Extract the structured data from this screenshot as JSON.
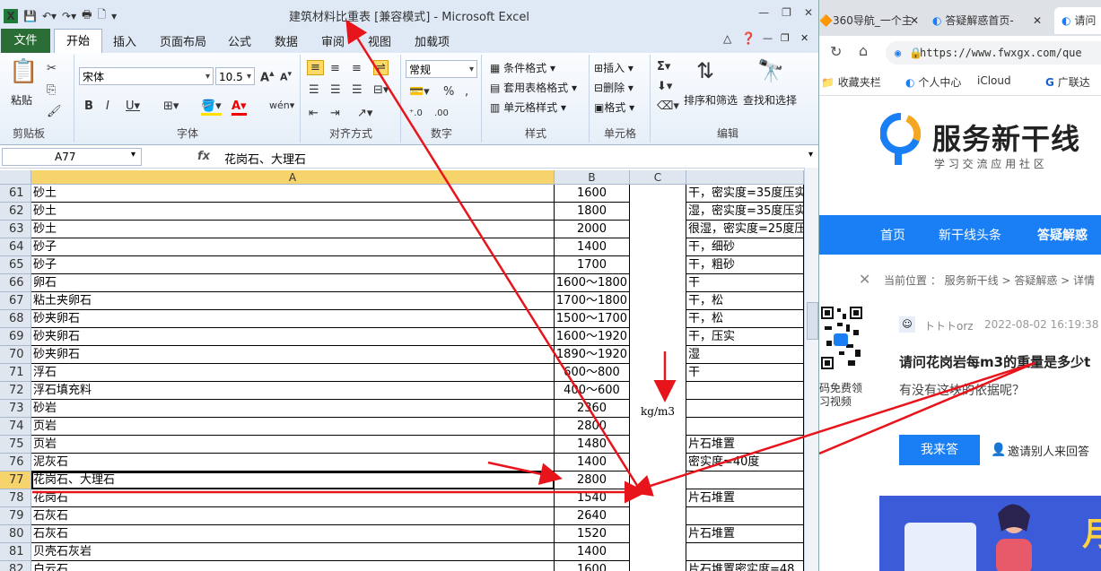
{
  "excel": {
    "window_title": "建筑材料比重表 [兼容模式] - Microsoft Excel",
    "tabs": [
      "文件",
      "开始",
      "插入",
      "页面布局",
      "公式",
      "数据",
      "审阅",
      "视图",
      "加载项"
    ],
    "groups": {
      "clipboard": {
        "label": "剪贴板",
        "paste": "粘贴"
      },
      "font": {
        "label": "字体",
        "font_name": "宋体",
        "font_size": "10.5"
      },
      "alignment": {
        "label": "对齐方式"
      },
      "number": {
        "label": "数字",
        "format": "常规"
      },
      "styles": {
        "label": "样式",
        "cond_format": "条件格式",
        "table_format": "套用表格格式",
        "cell_style": "单元格样式"
      },
      "cells": {
        "label": "单元格",
        "insert": "插入",
        "delete": "删除",
        "format": "格式"
      },
      "editing": {
        "label": "编辑",
        "sort_filter": "排序和筛选",
        "find_select": "查找和选择"
      }
    },
    "name_box": "A77",
    "formula": "花岗石、大理石",
    "columns": [
      "A",
      "B",
      "C"
    ],
    "unit_label": "kg/m3",
    "rows": [
      {
        "n": "61",
        "a": "砂土",
        "b": "1600",
        "d": "干，密实度=35度压实"
      },
      {
        "n": "62",
        "a": "砂土",
        "b": "1800",
        "d": "湿，密实度=35度压实"
      },
      {
        "n": "63",
        "a": "砂土",
        "b": "2000",
        "d": "很湿，密实度=25度压"
      },
      {
        "n": "64",
        "a": "砂子",
        "b": "1400",
        "d": "干，细砂"
      },
      {
        "n": "65",
        "a": "砂子",
        "b": "1700",
        "d": "干，粗砂"
      },
      {
        "n": "66",
        "a": "卵石",
        "b": "1600～1800",
        "d": "干"
      },
      {
        "n": "67",
        "a": "粘土夹卵石",
        "b": "1700～1800",
        "d": "干，松"
      },
      {
        "n": "68",
        "a": "砂夹卵石",
        "b": "1500～1700",
        "d": "干，松"
      },
      {
        "n": "69",
        "a": "砂夹卵石",
        "b": "1600～1920",
        "d": "干，压实"
      },
      {
        "n": "70",
        "a": "砂夹卵石",
        "b": "1890～1920",
        "d": "湿"
      },
      {
        "n": "71",
        "a": "浮石",
        "b": "600～800",
        "d": "干"
      },
      {
        "n": "72",
        "a": "浮石填充料",
        "b": "400～600",
        "d": ""
      },
      {
        "n": "73",
        "a": "砂岩",
        "b": "2360",
        "d": ""
      },
      {
        "n": "74",
        "a": "页岩",
        "b": "2800",
        "d": ""
      },
      {
        "n": "75",
        "a": "页岩",
        "b": "1480",
        "d": "片石堆置"
      },
      {
        "n": "76",
        "a": "泥灰石",
        "b": "1400",
        "d": "密实度=40度"
      },
      {
        "n": "77",
        "a": "花岗石、大理石",
        "b": "2800",
        "d": ""
      },
      {
        "n": "78",
        "a": "花岗石",
        "b": "1540",
        "d": "片石堆置"
      },
      {
        "n": "79",
        "a": "石灰石",
        "b": "2640",
        "d": ""
      },
      {
        "n": "80",
        "a": "石灰石",
        "b": "1520",
        "d": "片石堆置"
      },
      {
        "n": "81",
        "a": "贝壳石灰岩",
        "b": "1400",
        "d": ""
      },
      {
        "n": "82",
        "a": "白云石",
        "b": "1600",
        "d": "片石堆置密实度=48"
      }
    ]
  },
  "browser": {
    "tabs": [
      "360导航_一个主",
      "答疑解惑首页-",
      "请问"
    ],
    "url": "https://www.fwxgx.com/que",
    "bookmarks": [
      "收藏夹栏",
      "个人中心",
      "iCloud",
      "广联达"
    ],
    "site_name": "服务新干线",
    "site_slogan": "学 习 交 流 应 用 社 区",
    "nav": [
      "首页",
      "新干线头条",
      "答疑解惑"
    ],
    "breadcrumb": "当前位置 ： 服务新干线 > 答疑解惑 > 详情",
    "qr_caption_1": "码免费领",
    "qr_caption_2": "习视频",
    "question": {
      "user": "トトトorz",
      "time": "2022-08-02 16:19:38",
      "title": "请问花岗岩每m3的重量是多少t",
      "body": "有没有这块的依据呢？",
      "answer_btn": "我来答",
      "invite": "邀请别人来回答"
    },
    "banner_text": "月"
  },
  "colors": {
    "excel_green": "#2a6e35",
    "arrow_red": "#e8141c",
    "nav_blue": "#1a7ff5",
    "answer_blue": "#1a7ff5"
  }
}
